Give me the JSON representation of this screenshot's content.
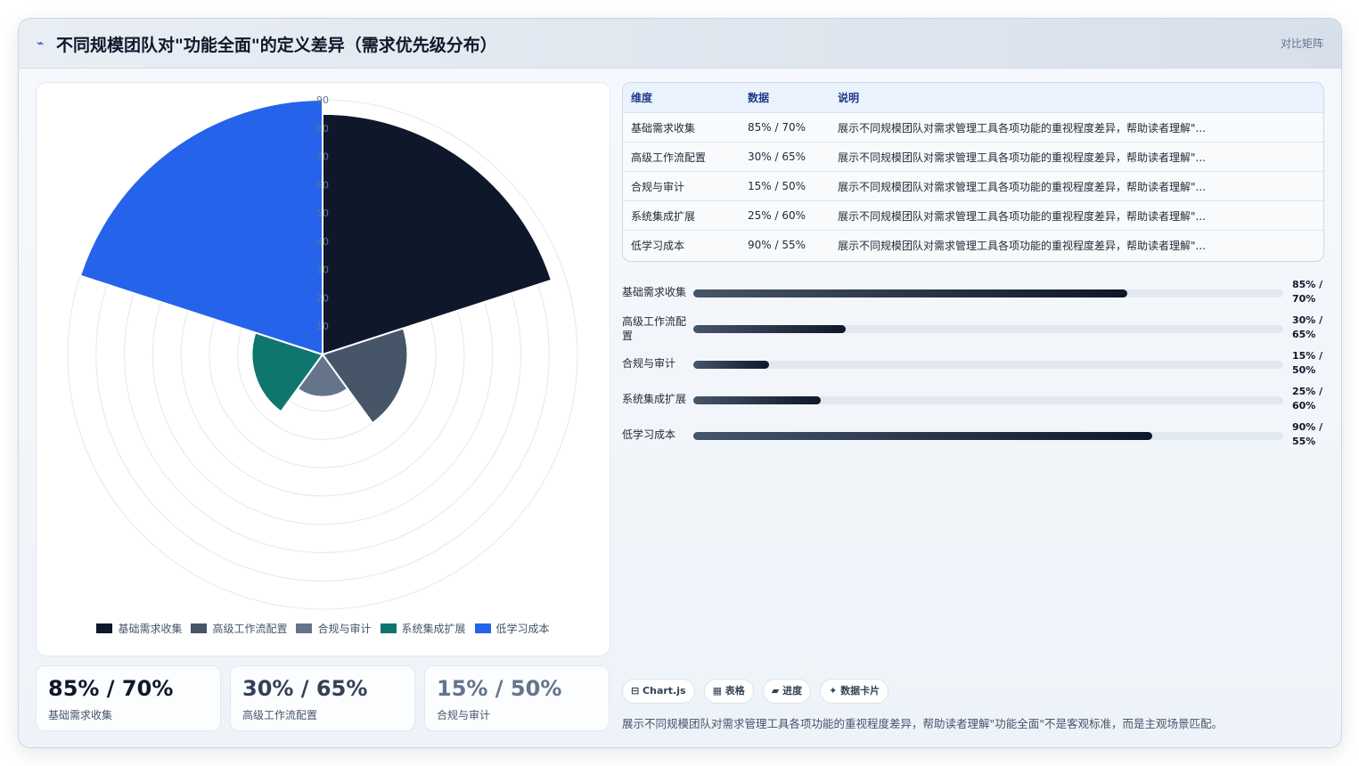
{
  "header": {
    "icon": "chart-icon",
    "title": "不同规模团队对\"功能全面\"的定义差异（需求优先级分布）",
    "right_label": "对比矩阵"
  },
  "chart_data": {
    "type": "polarArea",
    "categories": [
      "基础需求收集",
      "高级工作流配置",
      "合规与审计",
      "系统集成扩展",
      "低学习成本"
    ],
    "series": [
      {
        "values": [
          85,
          30,
          15,
          25,
          90
        ]
      }
    ],
    "colors": [
      "#0f172a",
      "#475569",
      "#64748b",
      "#0f766e",
      "#2563eb"
    ],
    "r_max": 90,
    "ticks": [
      10,
      20,
      30,
      40,
      50,
      60,
      70,
      80,
      90
    ],
    "legend_position": "bottom"
  },
  "stats": [
    {
      "value": "85% / 70%",
      "label": "基础需求收集",
      "color": "#0f172a"
    },
    {
      "value": "30% / 65%",
      "label": "高级工作流配置",
      "color": "#334155"
    },
    {
      "value": "15% / 50%",
      "label": "合规与审计",
      "color": "#64748b"
    }
  ],
  "table": {
    "headers": [
      "维度",
      "数据",
      "说明"
    ],
    "rows": [
      [
        "基础需求收集",
        "85% / 70%",
        "展示不同规模团队对需求管理工具各项功能的重视程度差异，帮助读者理解\"..."
      ],
      [
        "高级工作流配置",
        "30% / 65%",
        "展示不同规模团队对需求管理工具各项功能的重视程度差异，帮助读者理解\"..."
      ],
      [
        "合规与审计",
        "15% / 50%",
        "展示不同规模团队对需求管理工具各项功能的重视程度差异，帮助读者理解\"..."
      ],
      [
        "系统集成扩展",
        "25% / 60%",
        "展示不同规模团队对需求管理工具各项功能的重视程度差异，帮助读者理解\"..."
      ],
      [
        "低学习成本",
        "90% / 55%",
        "展示不同规模团队对需求管理工具各项功能的重视程度差异，帮助读者理解\"..."
      ]
    ]
  },
  "progress": [
    {
      "label": "基础需求收集",
      "value": "85% /\n70%",
      "fill": 0.735
    },
    {
      "label": "高级工作流配置",
      "value": "30% /\n65%",
      "fill": 0.259
    },
    {
      "label": "合规与审计",
      "value": "15% /\n50%",
      "fill": 0.129
    },
    {
      "label": "系统集成扩展",
      "value": "25% /\n60%",
      "fill": 0.216
    },
    {
      "label": "低学习成本",
      "value": "90% /\n55%",
      "fill": 0.778
    }
  ],
  "chips": [
    "⊟ Chart.js",
    "▦ 表格",
    "▰ 进度",
    "✦ 数据卡片"
  ],
  "footnote": "展示不同规模团队对需求管理工具各项功能的重视程度差异，帮助读者理解\"功能全面\"不是客观标准，而是主观场景匹配。"
}
